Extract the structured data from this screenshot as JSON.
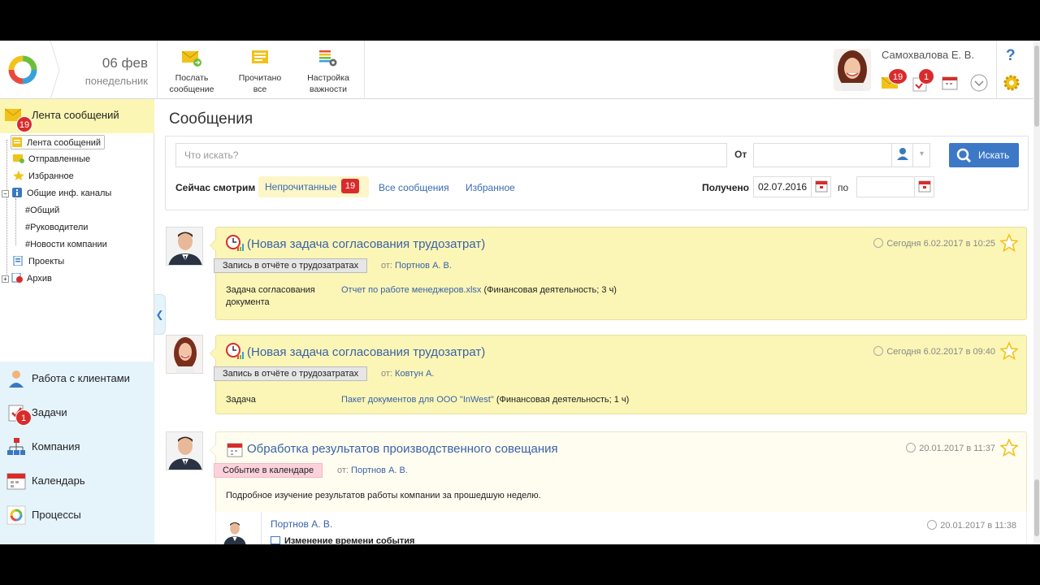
{
  "header": {
    "date_day": "06 фев",
    "date_weekday": "понедельник",
    "toolbar": [
      {
        "label": "Послать\nсообщение",
        "icon": "send-message-icon"
      },
      {
        "label": "Прочитано\nвсе",
        "icon": "mark-all-read-icon"
      },
      {
        "label": "Настройка\nважности",
        "icon": "importance-settings-icon"
      }
    ],
    "user_name": "Самохвалова Е. В.",
    "messages_badge": "19",
    "tasks_badge": "1",
    "help": "?"
  },
  "sidebar": {
    "feed_title": "Лента сообщений",
    "feed_badge": "19",
    "tree": [
      {
        "label": "Лента сообщений",
        "icon": "feed-icon"
      },
      {
        "label": "Отправленные",
        "icon": "sent-icon"
      },
      {
        "label": "Избранное",
        "icon": "star-icon"
      },
      {
        "label": "Общие инф. каналы",
        "icon": "info-channel-icon"
      },
      {
        "label": "#Общий"
      },
      {
        "label": "#Руководители"
      },
      {
        "label": "#Новости компании"
      },
      {
        "label": "Проекты",
        "icon": "projects-icon"
      },
      {
        "label": "Архив",
        "icon": "archive-icon"
      }
    ],
    "nav": [
      {
        "label": "Работа с клиентами",
        "icon": "clients-icon"
      },
      {
        "label": "Задачи",
        "icon": "tasks-icon",
        "badge": "1"
      },
      {
        "label": "Компания",
        "icon": "company-icon"
      },
      {
        "label": "Календарь",
        "icon": "calendar-icon"
      },
      {
        "label": "Процессы",
        "icon": "processes-icon"
      }
    ]
  },
  "main": {
    "title": "Сообщения",
    "search_placeholder": "Что искать?",
    "from_label": "От",
    "search_button": "Искать",
    "now_label": "Сейчас смотрим",
    "tabs": {
      "unread": "Непрочитанные",
      "unread_count": "19",
      "all": "Все сообщения",
      "favorites": "Избранное"
    },
    "received_label": "Получено",
    "date_from": "02.07.2016",
    "to_label": "по",
    "date_to": ""
  },
  "messages": [
    {
      "title": "(Новая задача согласования трудозатрат)",
      "date": "Сегодня 6.02.2017 в 10:25",
      "tag": "Запись в отчёте о трудозатратах",
      "from_prefix": "от:",
      "from": "Портнов А. В.",
      "key": "Задача согласования\nдокумента",
      "link": "Отчет по работе менеджеров.xlsx",
      "value_rest": " (Финансовая деятельность; 3 ч)"
    },
    {
      "title": "(Новая задача согласования трудозатрат)",
      "date": "Сегодня 6.02.2017 в 09:40",
      "tag": "Запись в отчёте о трудозатратах",
      "from_prefix": "от:",
      "from": "Ковтун А.",
      "key": "Задача",
      "link": "Пакет документов для ООО \"InWest\"",
      "value_rest": " (Финансовая деятельность; 1 ч)"
    },
    {
      "title": "Обработка результатов производственного совещания",
      "date": "20.01.2017 в 11:37",
      "tag": "Событие в календаре",
      "from_prefix": "от:",
      "from": "Портнов А. В.",
      "body": "Подробное изучение результатов работы компании за прошедшую неделю."
    }
  ],
  "reply": {
    "author": "Портнов А. В.",
    "date": "20.01.2017 в 11:38",
    "text": "Изменение времени события"
  },
  "colors": {
    "accent": "#3d78c6",
    "badge": "#d82c2c",
    "highlight": "#fbf6b6",
    "sidebar_bottom": "#e5f4fb"
  }
}
